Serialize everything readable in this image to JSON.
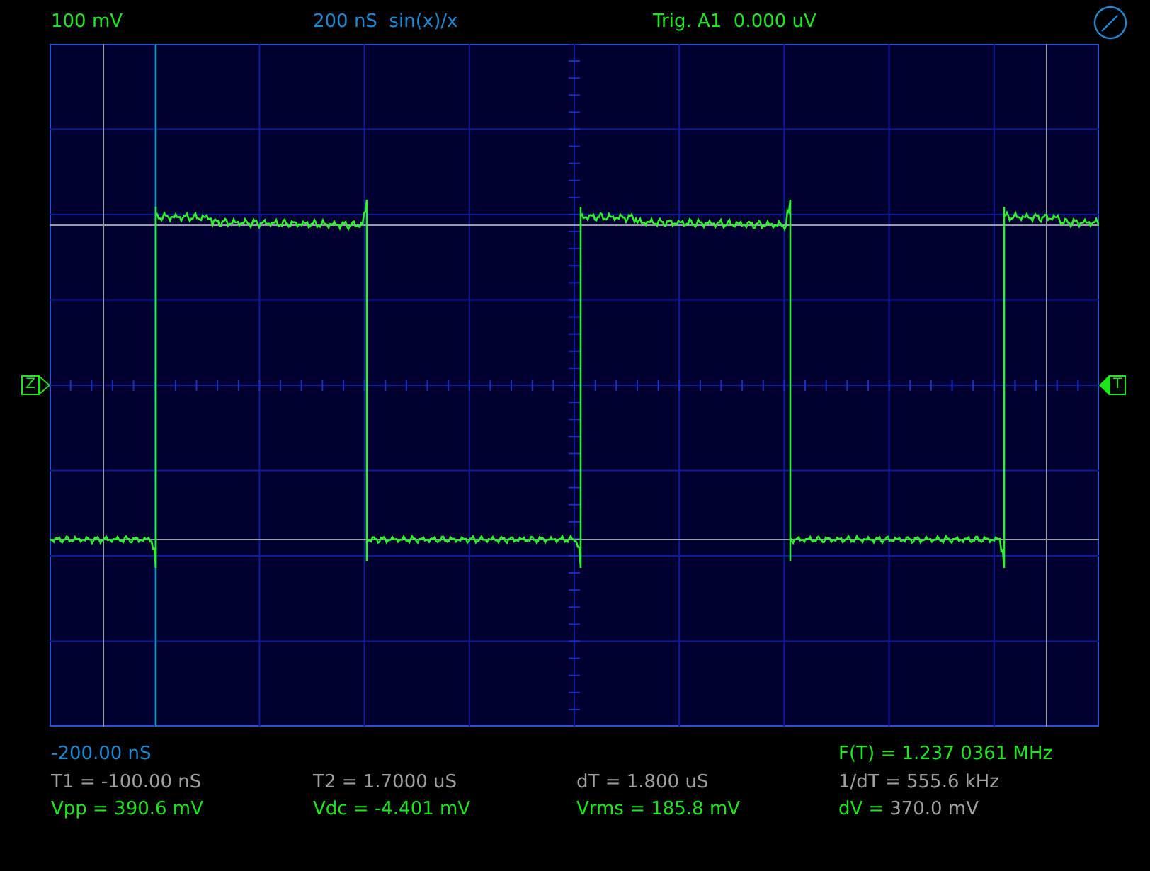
{
  "header": [
    {
      "text": "100 mV",
      "color": "#1ee61e"
    },
    {
      "text": "200 nS  sin(x)/x",
      "color": "#1a8ad4"
    },
    {
      "text": "Trig. A1  0.000 uV",
      "color": "#1ee61e"
    }
  ],
  "markers": {
    "left": "Z",
    "right": "T"
  },
  "footer": {
    "time_offset": {
      "text": "-200.00 nS",
      "color": "#1a8ad4"
    },
    "frequency": {
      "text": "F(T) = 1.237 0361 MHz",
      "color": "#1ee61e"
    },
    "cursor_readings": [
      {
        "parts": [
          {
            "text": "T1 = -100.00 nS",
            "color": "#a0a0a0"
          }
        ]
      },
      {
        "parts": [
          {
            "text": "T2 = 1.7000 uS",
            "color": "#a0a0a0"
          }
        ]
      },
      {
        "parts": [
          {
            "text": "dT = 1.800 uS",
            "color": "#a0a0a0"
          }
        ]
      },
      {
        "parts": [
          {
            "text": "1/dT = 555.6 kHz",
            "color": "#a0a0a0"
          }
        ]
      }
    ],
    "measurements": [
      {
        "parts": [
          {
            "text": "Vpp = 390.6 mV",
            "color": "#1ee61e"
          }
        ]
      },
      {
        "parts": [
          {
            "text": "Vdc = -4.401 mV",
            "color": "#1ee61e"
          }
        ]
      },
      {
        "parts": [
          {
            "text": "Vrms = 185.8 mV",
            "color": "#1ee61e"
          }
        ]
      },
      {
        "parts": [
          {
            "text": "dV =",
            "color": "#1ee61e"
          },
          {
            "text": "370.0 mV",
            "color": "#a0a0a0"
          }
        ]
      }
    ]
  }
}
